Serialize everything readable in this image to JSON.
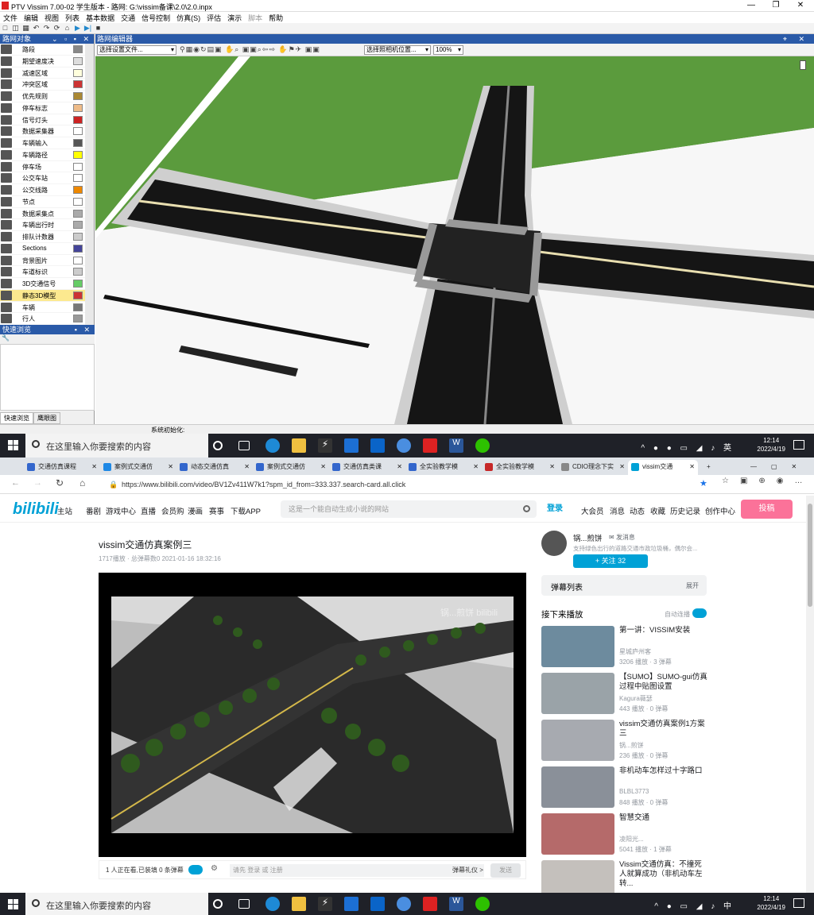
{
  "vissim": {
    "title": "PTV Vissim 7.00-02 学生版本 - 路网: G:\\vissim备课\\2.0\\2.0.inpx",
    "menu": [
      "文件",
      "编辑",
      "视图",
      "列表",
      "基本数据",
      "交通",
      "信号控制",
      "仿真(S)",
      "评估",
      "演示",
      "脚本",
      "帮助"
    ],
    "panel_title": "路网对象",
    "network_objects": [
      {
        "label": "路段",
        "icon": "link-icon"
      },
      {
        "label": "期望速度决",
        "icon": "desired-speed-icon"
      },
      {
        "label": "减速区域",
        "icon": "reduced-speed-icon"
      },
      {
        "label": "冲突区域",
        "icon": "conflict-area-icon"
      },
      {
        "label": "优先规则",
        "icon": "priority-rule-icon"
      },
      {
        "label": "停车标志",
        "icon": "stop-sign-icon"
      },
      {
        "label": "信号灯头",
        "icon": "signal-head-icon"
      },
      {
        "label": "数据采集器",
        "icon": "data-collection-icon"
      },
      {
        "label": "车辆输入",
        "icon": "vehicle-input-icon"
      },
      {
        "label": "车辆路径",
        "icon": "vehicle-route-icon"
      },
      {
        "label": "停车场",
        "icon": "parking-icon"
      },
      {
        "label": "公交车站",
        "icon": "bus-stop-icon"
      },
      {
        "label": "公交线路",
        "icon": "bus-line-icon"
      },
      {
        "label": "节点",
        "icon": "node-icon"
      },
      {
        "label": "数据采集点",
        "icon": "data-point-icon"
      },
      {
        "label": "车辆出行时",
        "icon": "travel-time-icon"
      },
      {
        "label": "排队计数器",
        "icon": "queue-counter-icon"
      },
      {
        "label": "Sections",
        "icon": "sections-icon"
      },
      {
        "label": "背景图片",
        "icon": "background-image-icon"
      },
      {
        "label": "车道标识",
        "icon": "lane-marking-icon"
      },
      {
        "label": "3D交通信号",
        "icon": "3d-signal-icon"
      },
      {
        "label": "静态3D模型",
        "icon": "static-3d-model-icon"
      },
      {
        "label": "车辆",
        "icon": "vehicle-icon"
      },
      {
        "label": "行人",
        "icon": "pedestrian-icon"
      }
    ],
    "quick_view_title": "快速浏览",
    "bottom_tabs": [
      "快速浏览",
      "鹰眼图"
    ],
    "editor_title": "路网编辑器",
    "file_select": "选择设置文件...",
    "camera_select": "选择照相机位置...",
    "zoom": "100%",
    "status": "系统初始化:"
  },
  "taskbar1": {
    "search": "在这里输入你要搜索的内容",
    "time": "12:14",
    "date": "2022/4/19",
    "lang": "英"
  },
  "browser": {
    "tabs": [
      "交通仿真课程",
      "案例式交通仿",
      "动态交通仿真",
      "案例式交通仿",
      "交通仿真类课",
      "全实验教学模",
      "全实验教学模",
      "CDIO理念下实",
      "vissim交通"
    ],
    "url": "https://www.bilibili.com/video/BV1Zv411W7k1?spm_id_from=333.337.search-card.all.click",
    "nav": [
      "主站",
      "番剧",
      "游戏中心",
      "直播",
      "会员购",
      "漫画",
      "赛事",
      "下载APP"
    ],
    "search_placeholder": "这是一个能自动生成小说的网站",
    "login": "登录",
    "right_nav": [
      "大会员",
      "消息",
      "动态",
      "收藏",
      "历史记录",
      "创作中心"
    ],
    "upload": "投稿",
    "video_title": "vissim交通仿真案例三",
    "video_meta": "1717播放 · 总弹幕数0   2021-01-16 18:32:16",
    "watermark": "锅...煎饼 bilibili",
    "watching": "1 人正在看,已装填 0 条弹幕",
    "danmaku_hint": "请先 登录 或 注册",
    "danmaku_etiquette": "弹幕礼仪 >",
    "send": "发送",
    "up_name": "锅...煎饼",
    "up_msg": "发消息",
    "up_desc": "支持绿色出行的道路交通市政垃圾桶，偶尔会...",
    "follow": "+ 关注 32",
    "danmaku_list": "弹幕列表",
    "expand": "展开",
    "next": "接下来播放",
    "autoplay": "自动连播",
    "recs": [
      {
        "title": "第一讲：VISSIM安装",
        "author": "星城庐州客",
        "stats": "3206 播放 · 3 弹幕"
      },
      {
        "title": "【SUMO】SUMO-gui仿真过程中贴图设置",
        "author": "Kagura薇瑟",
        "stats": "443 播放 · 0 弹幕"
      },
      {
        "title": "vissim交通仿真案例1方案三",
        "author": "锅...煎饼",
        "stats": "236 播放 · 0 弹幕"
      },
      {
        "title": "非机动车怎样过十字路口",
        "author": "BLBL3773",
        "stats": "848 播放 · 0 弹幕"
      },
      {
        "title": "智慧交通",
        "author": "凌阳光...",
        "stats": "5041 播放 · 1 弹幕"
      },
      {
        "title": "Vissim交通仿真：不撞死人就算成功（非机动车左转...",
        "author": "",
        "stats": ""
      }
    ]
  },
  "taskbar2": {
    "search": "在这里输入你要搜索的内容",
    "time": "12:14",
    "date": "2022/4/19",
    "lang": "中"
  },
  "colors": {
    "grass": "#5b9b3d",
    "road": "#1a1a1a",
    "bili_blue": "#00a1d6",
    "bili_pink": "#fb7299",
    "panel_blue": "#2a5aa8"
  }
}
